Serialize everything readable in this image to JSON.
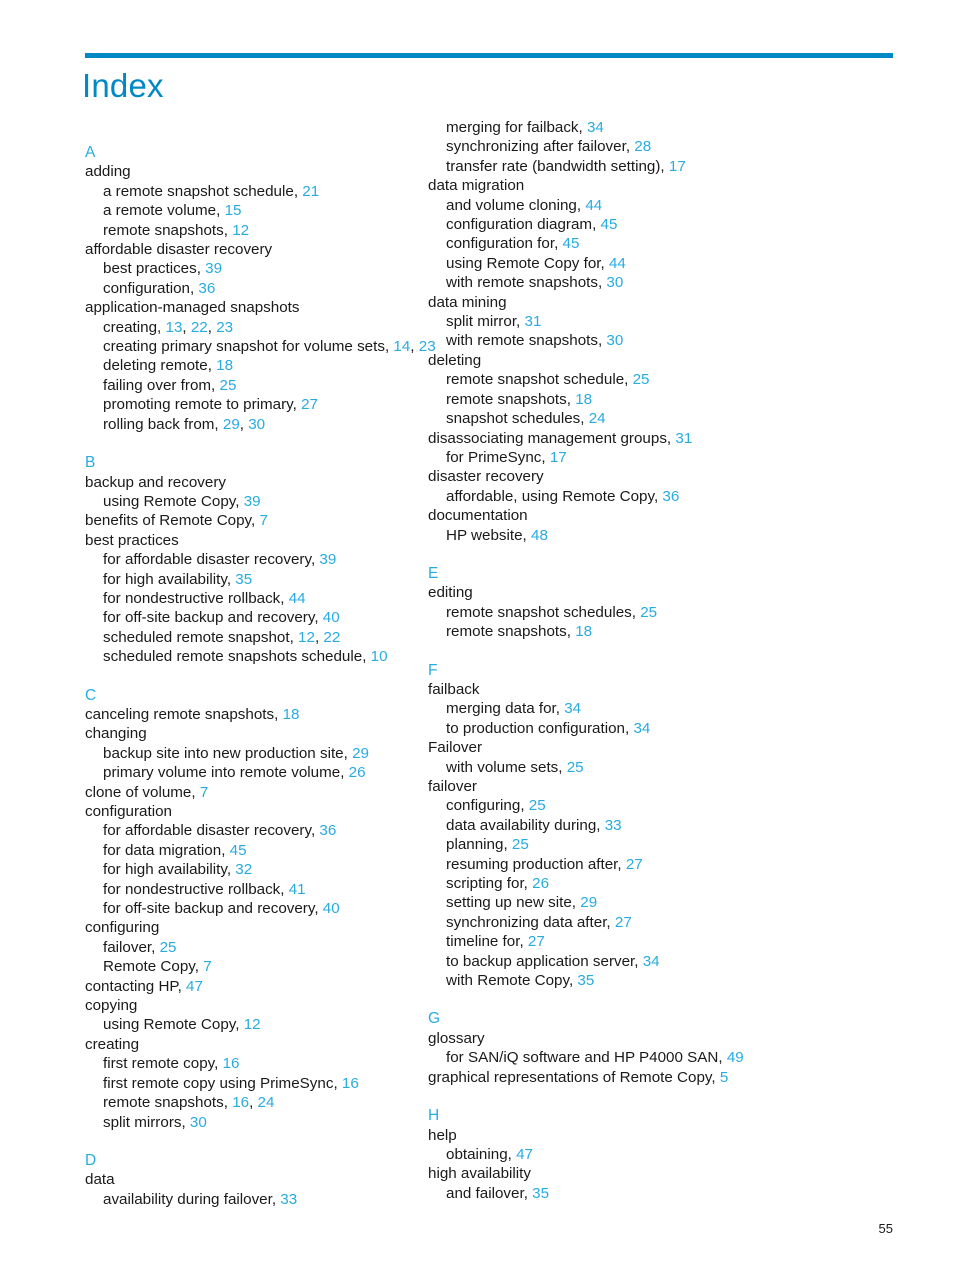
{
  "document": {
    "title": "Index",
    "page_number": "55",
    "accent_rule_color": "#0089c4",
    "title_color": "#0089c4",
    "link_color": "#29abe2",
    "text_color": "#1a1a1a"
  },
  "columns": [
    {
      "id": "left-column",
      "sections": [
        {
          "letter": "A",
          "entries": [
            {
              "level": 1,
              "text": "adding",
              "pages": []
            },
            {
              "level": 2,
              "text": "a remote snapshot schedule",
              "pages": [
                "21"
              ]
            },
            {
              "level": 2,
              "text": "a remote volume",
              "pages": [
                "15"
              ]
            },
            {
              "level": 2,
              "text": "remote snapshots",
              "pages": [
                "12"
              ]
            },
            {
              "level": 1,
              "text": "affordable disaster recovery",
              "pages": []
            },
            {
              "level": 2,
              "text": "best practices",
              "pages": [
                "39"
              ]
            },
            {
              "level": 2,
              "text": "configuration",
              "pages": [
                "36"
              ]
            },
            {
              "level": 1,
              "text": "application-managed snapshots",
              "pages": []
            },
            {
              "level": 2,
              "text": "creating",
              "pages": [
                "13",
                "22",
                "23"
              ]
            },
            {
              "level": 2,
              "text": "creating primary snapshot for volume sets",
              "pages": [
                "14",
                "23"
              ]
            },
            {
              "level": 2,
              "text": "deleting remote",
              "pages": [
                "18"
              ]
            },
            {
              "level": 2,
              "text": "failing over from",
              "pages": [
                "25"
              ]
            },
            {
              "level": 2,
              "text": "promoting remote to primary",
              "pages": [
                "27"
              ]
            },
            {
              "level": 2,
              "text": "rolling back from",
              "pages": [
                "29",
                "30"
              ]
            }
          ]
        },
        {
          "letter": "B",
          "entries": [
            {
              "level": 1,
              "text": "backup and recovery",
              "pages": []
            },
            {
              "level": 2,
              "text": "using Remote Copy",
              "pages": [
                "39"
              ]
            },
            {
              "level": 1,
              "text": "benefits of Remote Copy",
              "pages": [
                "7"
              ]
            },
            {
              "level": 1,
              "text": "best practices",
              "pages": []
            },
            {
              "level": 2,
              "text": "for affordable disaster recovery",
              "pages": [
                "39"
              ]
            },
            {
              "level": 2,
              "text": "for high availability",
              "pages": [
                "35"
              ]
            },
            {
              "level": 2,
              "text": "for nondestructive rollback",
              "pages": [
                "44"
              ]
            },
            {
              "level": 2,
              "text": "for off-site backup and recovery",
              "pages": [
                "40"
              ]
            },
            {
              "level": 2,
              "text": "scheduled remote snapshot",
              "pages": [
                "12",
                "22"
              ]
            },
            {
              "level": 2,
              "text": "scheduled remote snapshots schedule",
              "pages": [
                "10"
              ]
            }
          ]
        },
        {
          "letter": "C",
          "entries": [
            {
              "level": 1,
              "text": "canceling remote snapshots",
              "pages": [
                "18"
              ]
            },
            {
              "level": 1,
              "text": "changing",
              "pages": []
            },
            {
              "level": 2,
              "text": "backup site into new production site",
              "pages": [
                "29"
              ]
            },
            {
              "level": 2,
              "text": "primary volume into remote volume",
              "pages": [
                "26"
              ]
            },
            {
              "level": 1,
              "text": "clone of volume",
              "pages": [
                "7"
              ]
            },
            {
              "level": 1,
              "text": "configuration",
              "pages": []
            },
            {
              "level": 2,
              "text": "for affordable disaster recovery",
              "pages": [
                "36"
              ]
            },
            {
              "level": 2,
              "text": "for data migration",
              "pages": [
                "45"
              ]
            },
            {
              "level": 2,
              "text": "for high availability",
              "pages": [
                "32"
              ]
            },
            {
              "level": 2,
              "text": "for nondestructive rollback",
              "pages": [
                "41"
              ]
            },
            {
              "level": 2,
              "text": "for off-site backup and recovery",
              "pages": [
                "40"
              ]
            },
            {
              "level": 1,
              "text": "configuring",
              "pages": []
            },
            {
              "level": 2,
              "text": "failover",
              "pages": [
                "25"
              ]
            },
            {
              "level": 2,
              "text": "Remote Copy",
              "pages": [
                "7"
              ]
            },
            {
              "level": 1,
              "text": "contacting HP",
              "pages": [
                "47"
              ]
            },
            {
              "level": 1,
              "text": "copying",
              "pages": []
            },
            {
              "level": 2,
              "text": "using Remote Copy",
              "pages": [
                "12"
              ]
            },
            {
              "level": 1,
              "text": "creating",
              "pages": []
            },
            {
              "level": 2,
              "text": "first remote copy",
              "pages": [
                "16"
              ]
            },
            {
              "level": 2,
              "text": "first remote copy using PrimeSync",
              "pages": [
                "16"
              ]
            },
            {
              "level": 2,
              "text": "remote snapshots",
              "pages": [
                "16",
                "24"
              ]
            },
            {
              "level": 2,
              "text": "split mirrors",
              "pages": [
                "30"
              ]
            }
          ]
        },
        {
          "letter": "D",
          "entries": [
            {
              "level": 1,
              "text": "data",
              "pages": []
            },
            {
              "level": 2,
              "text": "availability during failover",
              "pages": [
                "33"
              ]
            }
          ]
        }
      ]
    },
    {
      "id": "right-column",
      "sections": [
        {
          "letter": "",
          "entries": [
            {
              "level": 2,
              "text": "merging for failback",
              "pages": [
                "34"
              ]
            },
            {
              "level": 2,
              "text": "synchronizing after failover",
              "pages": [
                "28"
              ]
            },
            {
              "level": 2,
              "text": "transfer rate (bandwidth setting)",
              "pages": [
                "17"
              ]
            },
            {
              "level": 1,
              "text": "data migration",
              "pages": []
            },
            {
              "level": 2,
              "text": "and volume cloning",
              "pages": [
                "44"
              ]
            },
            {
              "level": 2,
              "text": "configuration diagram",
              "pages": [
                "45"
              ]
            },
            {
              "level": 2,
              "text": "configuration for",
              "pages": [
                "45"
              ]
            },
            {
              "level": 2,
              "text": "using Remote Copy for",
              "pages": [
                "44"
              ]
            },
            {
              "level": 2,
              "text": "with remote snapshots",
              "pages": [
                "30"
              ]
            },
            {
              "level": 1,
              "text": "data mining",
              "pages": []
            },
            {
              "level": 2,
              "text": "split mirror",
              "pages": [
                "31"
              ]
            },
            {
              "level": 2,
              "text": "with remote snapshots",
              "pages": [
                "30"
              ]
            },
            {
              "level": 1,
              "text": "deleting",
              "pages": []
            },
            {
              "level": 2,
              "text": "remote snapshot schedule",
              "pages": [
                "25"
              ]
            },
            {
              "level": 2,
              "text": "remote snapshots",
              "pages": [
                "18"
              ]
            },
            {
              "level": 2,
              "text": "snapshot schedules",
              "pages": [
                "24"
              ]
            },
            {
              "level": 1,
              "text": "disassociating management groups",
              "pages": [
                "31"
              ]
            },
            {
              "level": 2,
              "text": "for PrimeSync",
              "pages": [
                "17"
              ]
            },
            {
              "level": 1,
              "text": "disaster recovery",
              "pages": []
            },
            {
              "level": 2,
              "text": "affordable, using Remote Copy",
              "pages": [
                "36"
              ]
            },
            {
              "level": 1,
              "text": "documentation",
              "pages": []
            },
            {
              "level": 2,
              "text": "HP website",
              "pages": [
                "48"
              ]
            }
          ]
        },
        {
          "letter": "E",
          "entries": [
            {
              "level": 1,
              "text": "editing",
              "pages": []
            },
            {
              "level": 2,
              "text": "remote snapshot schedules",
              "pages": [
                "25"
              ]
            },
            {
              "level": 2,
              "text": "remote snapshots",
              "pages": [
                "18"
              ]
            }
          ]
        },
        {
          "letter": "F",
          "entries": [
            {
              "level": 1,
              "text": "failback",
              "pages": []
            },
            {
              "level": 2,
              "text": "merging data for",
              "pages": [
                "34"
              ]
            },
            {
              "level": 2,
              "text": "to production configuration",
              "pages": [
                "34"
              ]
            },
            {
              "level": 1,
              "text": "Failover",
              "pages": []
            },
            {
              "level": 2,
              "text": "with volume sets",
              "pages": [
                "25"
              ]
            },
            {
              "level": 1,
              "text": "failover",
              "pages": []
            },
            {
              "level": 2,
              "text": "configuring",
              "pages": [
                "25"
              ]
            },
            {
              "level": 2,
              "text": "data availability during",
              "pages": [
                "33"
              ]
            },
            {
              "level": 2,
              "text": "planning",
              "pages": [
                "25"
              ]
            },
            {
              "level": 2,
              "text": "resuming production after",
              "pages": [
                "27"
              ]
            },
            {
              "level": 2,
              "text": "scripting for",
              "pages": [
                "26"
              ]
            },
            {
              "level": 2,
              "text": "setting up new site",
              "pages": [
                "29"
              ]
            },
            {
              "level": 2,
              "text": "synchronizing data after",
              "pages": [
                "27"
              ]
            },
            {
              "level": 2,
              "text": "timeline for",
              "pages": [
                "27"
              ]
            },
            {
              "level": 2,
              "text": "to backup application server",
              "pages": [
                "34"
              ]
            },
            {
              "level": 2,
              "text": "with Remote Copy",
              "pages": [
                "35"
              ]
            }
          ]
        },
        {
          "letter": "G",
          "entries": [
            {
              "level": 1,
              "text": "glossary",
              "pages": []
            },
            {
              "level": 2,
              "text": "for SAN/iQ software and HP P4000 SAN",
              "pages": [
                "49"
              ]
            },
            {
              "level": 1,
              "text": "graphical representations of Remote Copy",
              "pages": [
                "5"
              ]
            }
          ]
        },
        {
          "letter": "H",
          "entries": [
            {
              "level": 1,
              "text": "help",
              "pages": []
            },
            {
              "level": 2,
              "text": "obtaining",
              "pages": [
                "47"
              ]
            },
            {
              "level": 1,
              "text": "high availability",
              "pages": []
            },
            {
              "level": 2,
              "text": "and failover",
              "pages": [
                "35"
              ]
            }
          ]
        }
      ]
    }
  ]
}
